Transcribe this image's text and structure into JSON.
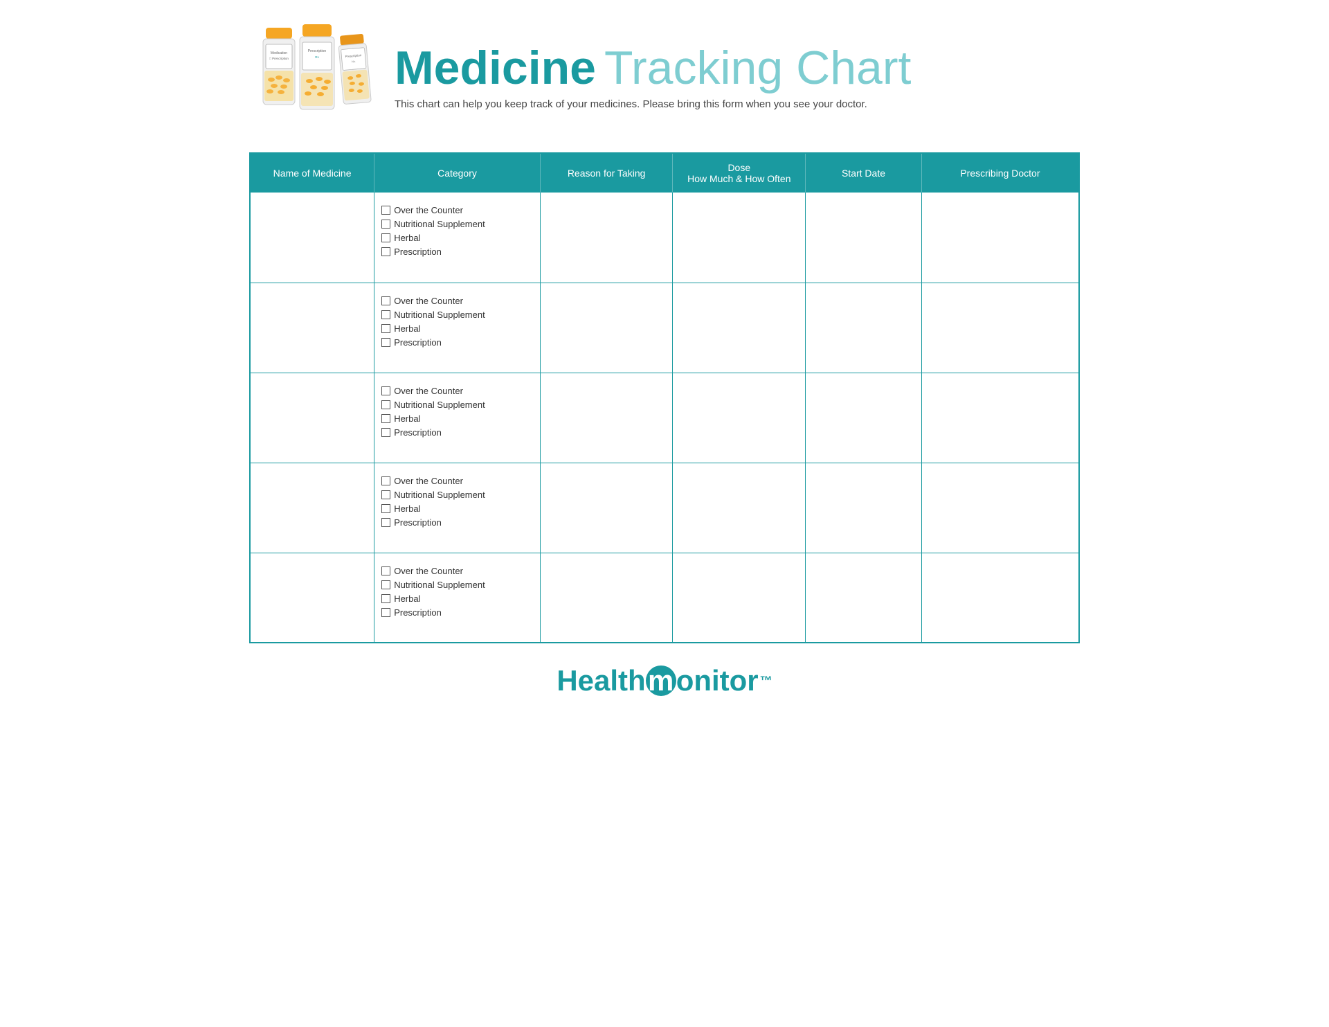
{
  "header": {
    "title_medicine": "Medicine",
    "title_rest": "Tracking Chart",
    "subtitle": "This chart can help you keep track of your medicines. Please bring this form when you see your doctor."
  },
  "table": {
    "columns": [
      {
        "id": "name",
        "label": "Name of Medicine"
      },
      {
        "id": "category",
        "label": "Category"
      },
      {
        "id": "reason",
        "label": "Reason for Taking"
      },
      {
        "id": "dose",
        "label": "Dose\nHow Much & How Often"
      },
      {
        "id": "start",
        "label": "Start Date"
      },
      {
        "id": "doctor",
        "label": "Prescribing Doctor"
      }
    ],
    "category_options": [
      "Over the Counter",
      "Nutritional Supplement",
      "Herbal",
      "Prescription"
    ],
    "row_count": 5
  },
  "footer": {
    "logo_health": "Health",
    "logo_circle_letter": "m",
    "logo_monitor": "onitor",
    "logo_tm": "™"
  }
}
